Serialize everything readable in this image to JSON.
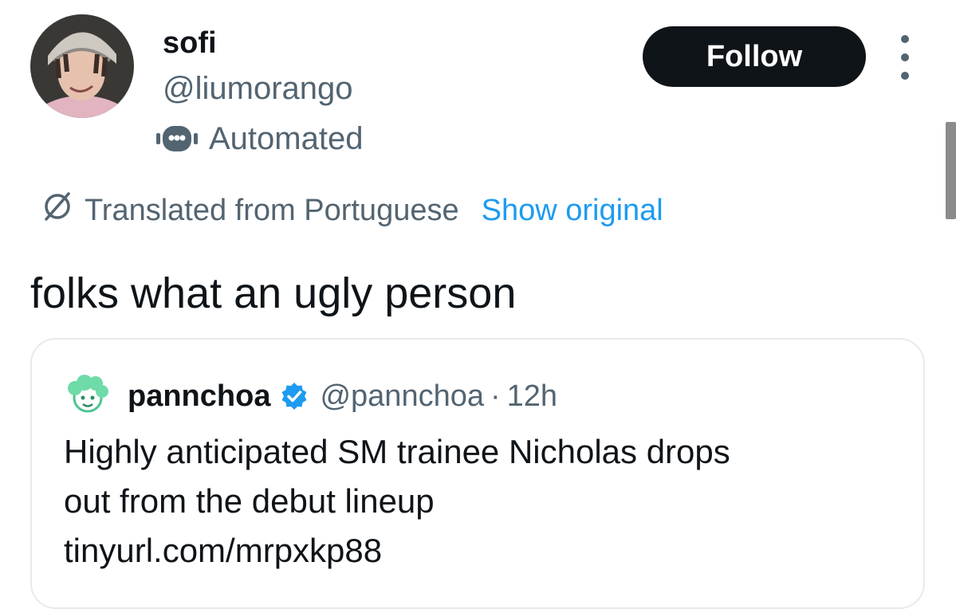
{
  "author": {
    "display_name": "sofi",
    "handle": "@liumorango",
    "automated_label": "Automated",
    "avatar_icon": "profile-photo",
    "automated_icon": "robot-icon"
  },
  "actions": {
    "follow_label": "Follow",
    "more_icon": "more-vertical-icon"
  },
  "translation": {
    "icon": "globe-slash-icon",
    "label": "Translated from Portuguese",
    "show_original": "Show original"
  },
  "tweet": {
    "text": "folks what an ugly person"
  },
  "quote": {
    "display_name": "pannchoa",
    "handle": "@pannchoa",
    "separator": "·",
    "time": "12h",
    "verified_icon": "verified-badge-icon",
    "text_line_1": "Highly anticipated SM trainee Nicholas drops",
    "text_line_2": "out from the debut lineup",
    "link": "tinyurl.com/mrpxkp88"
  },
  "colors": {
    "primary_text": "#0f1419",
    "secondary_text": "#536471",
    "link_blue": "#1d9bf0",
    "verified_blue": "#1d9bf0",
    "follow_bg": "#0f1419",
    "border": "#e7e9ea"
  }
}
